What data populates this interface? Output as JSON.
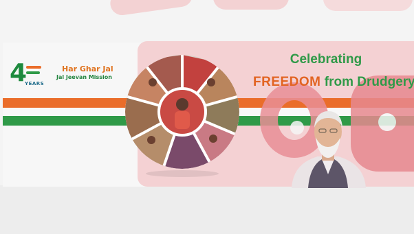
{
  "logo": {
    "number": "4",
    "years": "YEARS",
    "title": "Har Ghar Jal",
    "subtitle": "Jal Jeevan Mission"
  },
  "headline": {
    "line1": "Celebrating",
    "emphasis": "FREEDOM",
    "rest": " from Drudgery"
  },
  "colors": {
    "saffron": "#ea6d2a",
    "green": "#2f9a48",
    "watermark_pink": "#f3cfd1",
    "watermark_red": "#e98f96"
  },
  "images": {
    "collage": "circular-photo-collage",
    "portrait": "man-portrait-white-beard"
  }
}
